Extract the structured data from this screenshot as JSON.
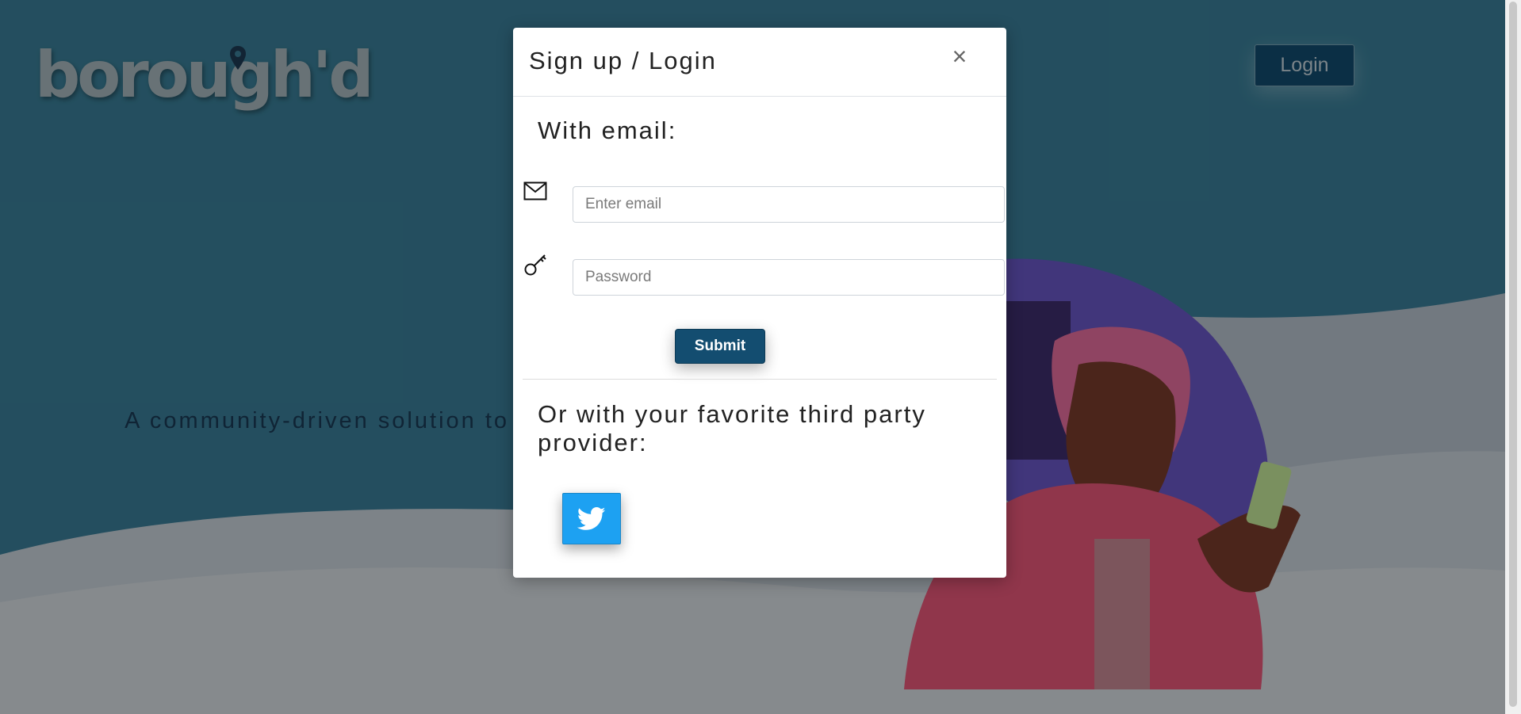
{
  "brand": {
    "logo_text": "borough'd"
  },
  "header": {
    "login_label": "Login"
  },
  "hero": {
    "tagline": "A community-driven solution to finding your next"
  },
  "modal": {
    "title": "Sign up / Login",
    "close_label": "×",
    "email_heading": "With email:",
    "email_placeholder": "Enter email",
    "password_placeholder": "Password",
    "submit_label": "Submit",
    "third_party_heading": "Or with your favorite third party provider:",
    "providers": [
      "twitter-icon"
    ]
  },
  "icons": {
    "email": "envelope-icon",
    "password": "key-icon"
  },
  "colors": {
    "primary": "#134d70",
    "twitter": "#1da1f2",
    "overlay": "rgba(0,0,0,0.38)"
  }
}
